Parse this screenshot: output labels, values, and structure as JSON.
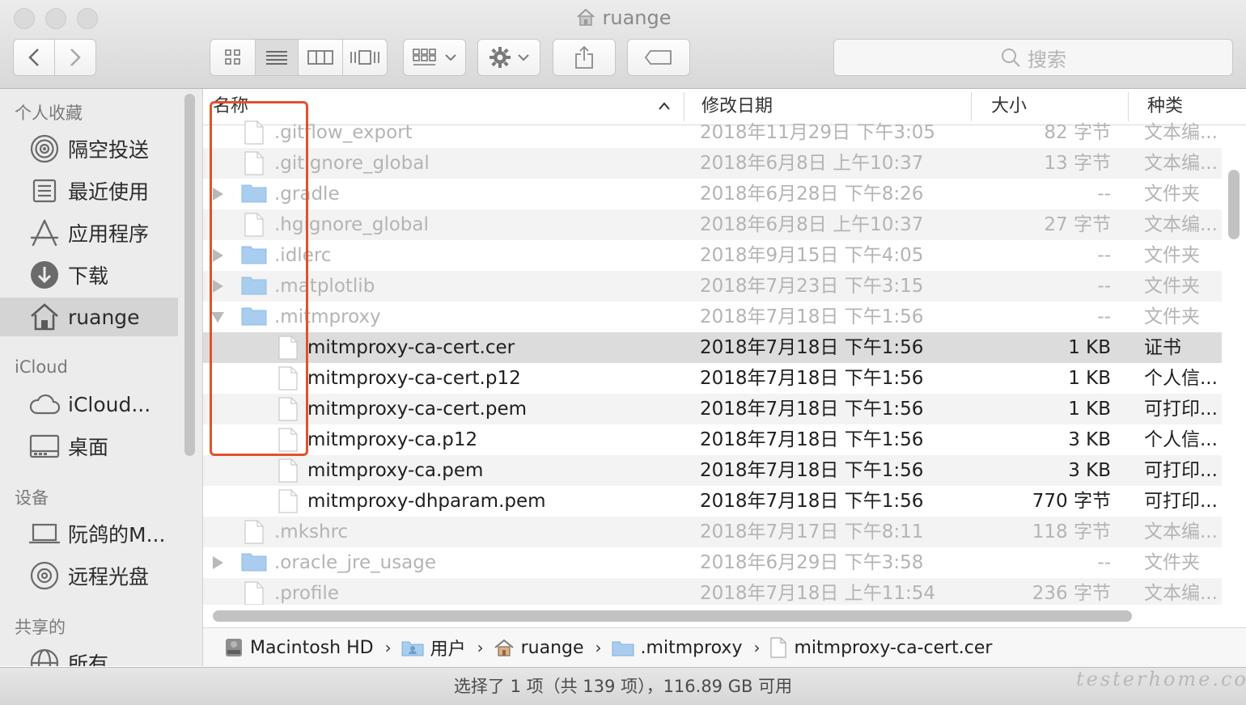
{
  "window": {
    "title": "ruange"
  },
  "toolbar": {
    "search_placeholder": "搜索"
  },
  "sidebar": {
    "sections": [
      {
        "header": "个人收藏"
      },
      {
        "header": "iCloud"
      },
      {
        "header": "设备"
      },
      {
        "header": "共享的"
      }
    ],
    "items": [
      {
        "label": "隔空投送",
        "icon": "airdrop-icon"
      },
      {
        "label": "最近使用",
        "icon": "recents-icon"
      },
      {
        "label": "应用程序",
        "icon": "applications-icon"
      },
      {
        "label": "下载",
        "icon": "downloads-icon"
      },
      {
        "label": "ruange",
        "icon": "home-icon",
        "selected": true
      },
      {
        "label": "iCloud...",
        "icon": "cloud-icon"
      },
      {
        "label": "桌面",
        "icon": "desktop-icon"
      },
      {
        "label": "阮鸽的M...",
        "icon": "laptop-icon"
      },
      {
        "label": "远程光盘",
        "icon": "disc-icon"
      },
      {
        "label": "所有",
        "icon": "network-icon"
      }
    ]
  },
  "columns": {
    "name": "名称",
    "date": "修改日期",
    "size": "大小",
    "kind": "种类"
  },
  "files": [
    {
      "name": ".gitflow_export",
      "date": "2018年11月29日 下午3:05",
      "size": "82 字节",
      "kind": "文本编...",
      "type": "file",
      "dim": true
    },
    {
      "name": ".gitignore_global",
      "date": "2018年6月8日 上午10:37",
      "size": "13 字节",
      "kind": "文本编...",
      "type": "file",
      "dim": true
    },
    {
      "name": ".gradle",
      "date": "2018年6月28日 下午8:26",
      "size": "--",
      "kind": "文件夹",
      "type": "folder",
      "dim": true
    },
    {
      "name": ".hgignore_global",
      "date": "2018年6月8日 上午10:37",
      "size": "27 字节",
      "kind": "文本编...",
      "type": "file",
      "dim": true
    },
    {
      "name": ".idlerc",
      "date": "2018年9月15日 下午4:05",
      "size": "--",
      "kind": "文件夹",
      "type": "folder",
      "dim": true
    },
    {
      "name": ".matplotlib",
      "date": "2018年7月23日 下午3:15",
      "size": "--",
      "kind": "文件夹",
      "type": "folder",
      "dim": true
    },
    {
      "name": ".mitmproxy",
      "date": "2018年7月18日 下午1:56",
      "size": "--",
      "kind": "文件夹",
      "type": "folder-open",
      "dim": true
    },
    {
      "name": "mitmproxy-ca-cert.cer",
      "date": "2018年7月18日 下午1:56",
      "size": "1 KB",
      "kind": "证书",
      "type": "child",
      "selected": true
    },
    {
      "name": "mitmproxy-ca-cert.p12",
      "date": "2018年7月18日 下午1:56",
      "size": "1 KB",
      "kind": "个人信...",
      "type": "child"
    },
    {
      "name": "mitmproxy-ca-cert.pem",
      "date": "2018年7月18日 下午1:56",
      "size": "1 KB",
      "kind": "可打印...",
      "type": "child"
    },
    {
      "name": "mitmproxy-ca.p12",
      "date": "2018年7月18日 下午1:56",
      "size": "3 KB",
      "kind": "个人信...",
      "type": "child"
    },
    {
      "name": "mitmproxy-ca.pem",
      "date": "2018年7月18日 下午1:56",
      "size": "3 KB",
      "kind": "可打印...",
      "type": "child"
    },
    {
      "name": "mitmproxy-dhparam.pem",
      "date": "2018年7月18日 下午1:56",
      "size": "770 字节",
      "kind": "可打印...",
      "type": "child"
    },
    {
      "name": ".mkshrc",
      "date": "2018年7月17日 下午8:11",
      "size": "118 字节",
      "kind": "文本编...",
      "type": "file",
      "dim": true
    },
    {
      "name": ".oracle_jre_usage",
      "date": "2018年6月29日 下午3:58",
      "size": "--",
      "kind": "文件夹",
      "type": "folder",
      "dim": true
    },
    {
      "name": ".profile",
      "date": "2018年7月18日 上午11:54",
      "size": "236 字节",
      "kind": "文本编...",
      "type": "file",
      "dim": true
    }
  ],
  "pathbar": [
    {
      "label": "Macintosh HD",
      "icon": "hard-drive-icon"
    },
    {
      "label": "用户",
      "icon": "folder-icon"
    },
    {
      "label": "ruange",
      "icon": "home-icon"
    },
    {
      "label": ".mitmproxy",
      "icon": "folder-icon"
    },
    {
      "label": "mitmproxy-ca-cert.cer",
      "icon": "file-icon"
    }
  ],
  "status": {
    "text": "选择了 1 项（共 139 项），116.89 GB 可用"
  },
  "watermark": {
    "text": "testerhome.com"
  },
  "colors": {
    "highlight": "#e2512e",
    "folder": "#a8cdee"
  }
}
